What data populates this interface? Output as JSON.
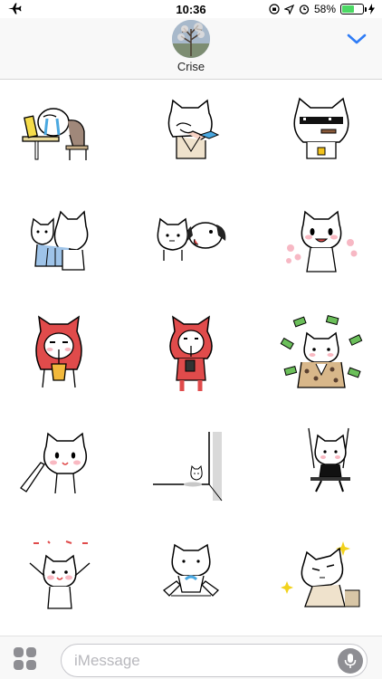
{
  "status_bar": {
    "airplane_icon": "airplane-icon",
    "time": "10:36",
    "battery_percent": "58%",
    "battery_level": 0.58
  },
  "header": {
    "contact_name": "Crise",
    "avatar_icon": "contact-avatar",
    "chevron_icon": "chevron-down-icon",
    "accent_color": "#2f7cf6"
  },
  "stickers": [
    {
      "id": "cat-crying-at-desk"
    },
    {
      "id": "cat-facepalm"
    },
    {
      "id": "cat-sunglasses-cigar"
    },
    {
      "id": "cat-hug-back"
    },
    {
      "id": "cat-with-dog-kiss"
    },
    {
      "id": "cat-with-flowers"
    },
    {
      "id": "cat-red-hood-drink"
    },
    {
      "id": "cat-red-hood-standing"
    },
    {
      "id": "cat-money-rain"
    },
    {
      "id": "cat-poke-finger"
    },
    {
      "id": "cat-corner-small"
    },
    {
      "id": "cat-swing"
    },
    {
      "id": "cat-cheering"
    },
    {
      "id": "cat-squeezed-hands"
    },
    {
      "id": "cat-sleepy-sparkles"
    }
  ],
  "input": {
    "placeholder": "iMessage",
    "apps_icon": "apps-grid-icon",
    "mic_icon": "microphone-icon"
  },
  "colors": {
    "chrome_bg": "#f8f8f8",
    "battery_green": "#4cd964",
    "sticker_red": "#e04b4b",
    "money_green": "#6bbf5a"
  }
}
